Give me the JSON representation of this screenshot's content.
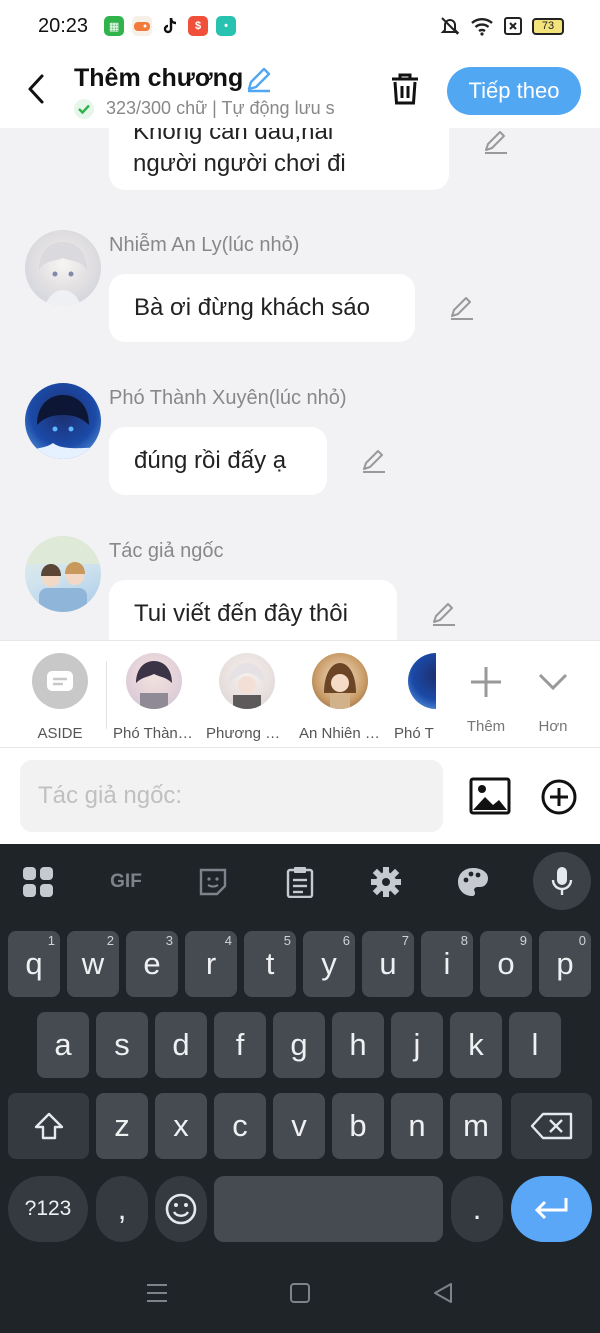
{
  "status_bar": {
    "time": "20:23",
    "battery": "73"
  },
  "header": {
    "title": "Thêm chương",
    "subtitle": "323/300 chữ | Tự động lưu s",
    "next_label": "Tiếp theo"
  },
  "messages": [
    {
      "text_line1": "Không cần đâu,hai",
      "text_line2": "người người chơi đi"
    },
    {
      "name": "Nhiễm An Ly(lúc nhỏ)",
      "text": "Bà ơi đừng khách sáo"
    },
    {
      "name": "Phó Thành Xuyên(lúc nhỏ)",
      "text": "đúng rồi đấy ạ"
    },
    {
      "name": "Tác giả ngốc",
      "text": "Tui viết đến đây thôi"
    }
  ],
  "characters": [
    {
      "label": "ASIDE"
    },
    {
      "label": "Phó Thành Xuyên"
    },
    {
      "label": "Phương Nhã"
    },
    {
      "label": "An Nhiên Nhi"
    },
    {
      "label": "Phó T"
    }
  ],
  "char_actions": {
    "more_label": "Thêm",
    "expand_label": "Hơn"
  },
  "input": {
    "placeholder": "Tác giả ngốc:"
  },
  "keyboard": {
    "row1": [
      "q",
      "w",
      "e",
      "r",
      "t",
      "y",
      "u",
      "i",
      "o",
      "p"
    ],
    "row1_nums": [
      "1",
      "2",
      "3",
      "4",
      "5",
      "6",
      "7",
      "8",
      "9",
      "0"
    ],
    "row2": [
      "a",
      "s",
      "d",
      "f",
      "g",
      "h",
      "j",
      "k",
      "l"
    ],
    "row3": [
      "z",
      "x",
      "c",
      "v",
      "b",
      "n",
      "m"
    ],
    "symbols_label": "?123",
    "comma": ",",
    "period": ".",
    "gif_label": "GIF"
  },
  "colors": {
    "accent": "#52a7f2",
    "keyboard_bg": "#1f2429",
    "key_bg": "#464b52",
    "enter": "#5aa7f8"
  }
}
